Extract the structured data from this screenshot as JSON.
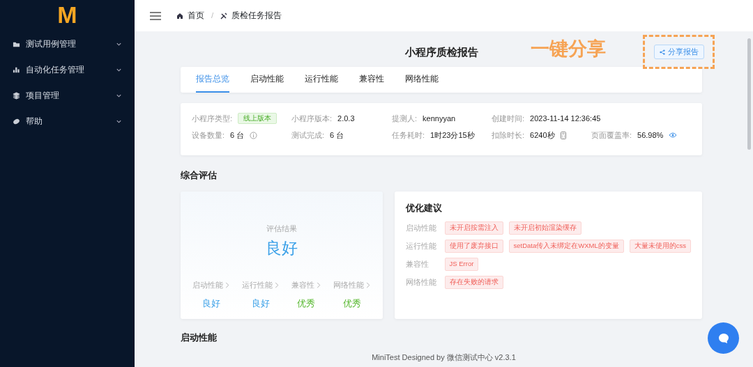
{
  "logo": "M",
  "sidebar": {
    "items": [
      {
        "label": "测试用例管理",
        "expanded": false
      },
      {
        "label": "自动化任务管理",
        "expanded": false
      },
      {
        "label": "项目管理",
        "expanded": false
      },
      {
        "label": "帮助",
        "expanded": false
      }
    ]
  },
  "breadcrumb": {
    "items": [
      {
        "label": "首页"
      },
      {
        "label": "质检任务报告"
      }
    ],
    "separator": "/"
  },
  "page_title": "小程序质检报告",
  "annotation": "一键分享",
  "share_button": "分享报告",
  "tabs": [
    {
      "label": "报告总览",
      "selected": true
    },
    {
      "label": "启动性能",
      "selected": false
    },
    {
      "label": "运行性能",
      "selected": false
    },
    {
      "label": "兼容性",
      "selected": false
    },
    {
      "label": "网络性能",
      "selected": false
    }
  ],
  "info": {
    "rows": [
      [
        {
          "label": "小程序类型:",
          "value": "线上版本",
          "kind": "tag"
        },
        {
          "label": "小程序版本:",
          "value": "2.0.3",
          "kind": "text"
        },
        {
          "label": "提测人:",
          "value": "kennyyan",
          "kind": "text"
        },
        {
          "label": "创建时间:",
          "value": "2023-11-14 12:36:45",
          "kind": "text"
        }
      ],
      [
        {
          "label": "设备数量:",
          "value": "6 台",
          "kind": "info"
        },
        {
          "label": "测试完成:",
          "value": "6 台",
          "kind": "text"
        },
        {
          "label": "任务耗时:",
          "value": "1时23分15秒",
          "kind": "text"
        },
        {
          "label": "扣除时长:",
          "value": "6240秒",
          "kind": "calc"
        },
        {
          "label": "页面覆盖率:",
          "value": "56.98%",
          "kind": "eye"
        }
      ]
    ]
  },
  "overall_heading": "综合评估",
  "evaluation": {
    "label": "评估结果",
    "result": "良好",
    "categories": [
      {
        "label": "启动性能",
        "rating": "良好",
        "color": "#3aa0e8"
      },
      {
        "label": "运行性能",
        "rating": "良好",
        "color": "#3aa0e8"
      },
      {
        "label": "兼容性",
        "rating": "优秀",
        "color": "#57b82f"
      },
      {
        "label": "网络性能",
        "rating": "优秀",
        "color": "#57b82f"
      }
    ]
  },
  "suggestions": {
    "title": "优化建议",
    "rows": [
      {
        "label": "启动性能",
        "tags": [
          "未开启按需注入",
          "未开启初始渲染缓存"
        ]
      },
      {
        "label": "运行性能",
        "tags": [
          "使用了废弃接口",
          "setData传入未绑定在WXML的变量",
          "大量未使用的css"
        ]
      },
      {
        "label": "兼容性",
        "tags": [
          "JS Error"
        ]
      },
      {
        "label": "网络性能",
        "tags": [
          "存在失败的请求"
        ]
      }
    ]
  },
  "startup_heading": "启动性能",
  "footer": "MiniTest Designed by 微信测试中心 v2.3.1"
}
